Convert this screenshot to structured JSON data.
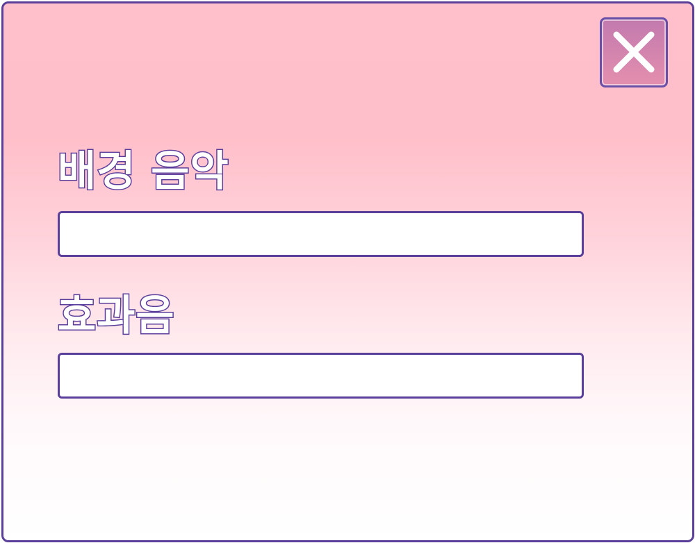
{
  "dialog": {
    "close_icon": "close-x-icon",
    "colors": {
      "border": "#5a3f9a",
      "gradient_top": "#ffbfcb",
      "gradient_bottom": "#ffffff",
      "close_button_top": "#c27aae",
      "close_button_bottom": "#e48fae"
    }
  },
  "settings": {
    "bgm": {
      "label": "배경 음악",
      "value": ""
    },
    "sfx": {
      "label": "효과음",
      "value": ""
    }
  }
}
